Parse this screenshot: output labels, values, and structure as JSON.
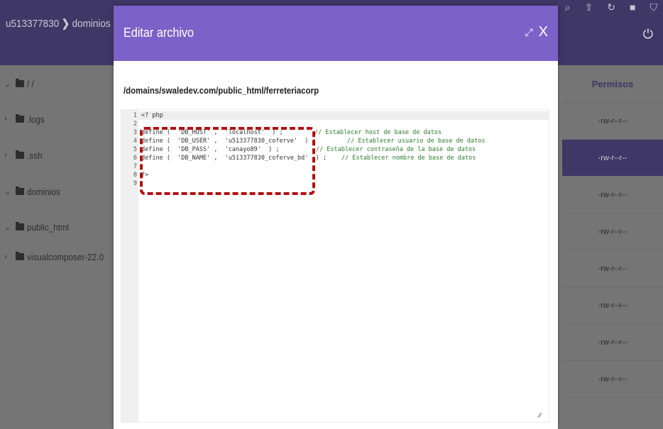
{
  "background": {
    "breadcrumb": [
      "u513377830",
      "dominios"
    ],
    "sidebar": {
      "root": "/ /",
      "items": [
        {
          "label": ".logs"
        },
        {
          "label": ".ssh"
        },
        {
          "label": "dominios"
        },
        {
          "label": "public_html"
        },
        {
          "label": "visualcomposer-22.0"
        }
      ]
    },
    "permissions": {
      "header": "Permisos",
      "rows": [
        "-rw-r--r--",
        "-rw-r--r--",
        "-rw-r--r--",
        "-rw-r--r--",
        "-rw-r--r--",
        "-rw-r--r--",
        "-rw-r--r--",
        "-rw-r--r--"
      ]
    }
  },
  "modal": {
    "title": "Editar archivo",
    "close_label": "X",
    "file_path": "/domains/swaledev.com/public_html/ferreteriacorp"
  },
  "editor": {
    "line_numbers": [
      "1",
      "2",
      "3",
      "4",
      "5",
      "6",
      "7",
      "8",
      "9"
    ],
    "lines": {
      "l1": "<? php",
      "l3": "define (  'DB_HOST' ,  'localhost'  ) ;",
      "l4": "define (  'DB_USER' ,  'u513377830_coferve'  ) ;",
      "l5": "define (  'DB_PASS' ,  'canayo89'  ) ;",
      "l6": "define (  'DB_NAME' ,  'u513377830_coferve_bd'  ) ;",
      "l8": "?>"
    },
    "comments": {
      "c3": "// Establecer host de base de datos",
      "c4": "// Establecer usuario de base de datos",
      "c5": "// Establecer contraseña de la base de datos",
      "c6": "// Establecer nombre de base de datos"
    }
  },
  "colors": {
    "header_purple": "#7c62c8",
    "highlight_red": "#b01010",
    "comment_green": "#2d7a2d"
  }
}
